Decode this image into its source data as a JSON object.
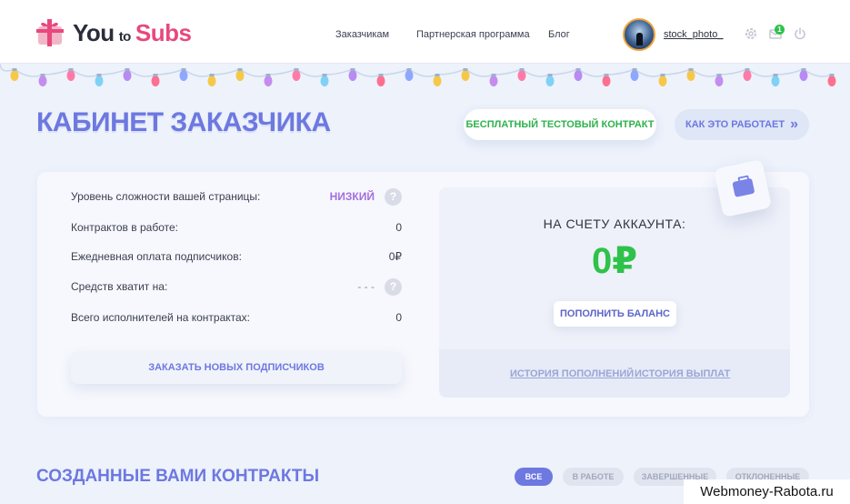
{
  "header": {
    "logo": {
      "you": "You",
      "to": "to",
      "subs": "Subs"
    },
    "nav": [
      {
        "label": "Заказчикам"
      },
      {
        "label": "Партнерская программа"
      },
      {
        "label": "Блог"
      }
    ],
    "username": "stock_photo_",
    "notifications_count": "1"
  },
  "page": {
    "title": "КАБИНЕТ ЗАКАЗЧИКА",
    "free_contract_button": "БЕСПЛАТНЫЙ ТЕСТОВЫЙ КОНТРАКТ",
    "how_it_works_button": "КАК ЭТО РАБОТАЕТ",
    "how_it_works_arrows": "»"
  },
  "stats": [
    {
      "label": "Уровень сложности вашей страницы:",
      "value": "НИЗКИЙ"
    },
    {
      "label": "Контрактов в работе:",
      "value": "0"
    },
    {
      "label": "Ежедневная оплата подписчиков:",
      "value": "0₽"
    },
    {
      "label": "Средств хватит на:",
      "value": "- - -"
    },
    {
      "label": "Всего исполнителей на контрактах:",
      "value": "0"
    }
  ],
  "order_button": "ЗАКАЗАТЬ НОВЫХ ПОДПИСЧИКОВ",
  "balance": {
    "label": "НА СЧЕТУ АККАУНТА:",
    "amount": "0₽",
    "topup_button": "ПОПОЛНИТЬ БАЛАНС",
    "history_topups": "ИСТОРИЯ ПОПОЛНЕНИЙ",
    "history_payouts": "ИСТОРИЯ ВЫПЛАТ"
  },
  "contracts": {
    "title": "СОЗДАННЫЕ ВАМИ КОНТРАКТЫ",
    "filters": [
      {
        "label": "ВСЕ",
        "active": true
      },
      {
        "label": "В РАБОТЕ",
        "active": false
      },
      {
        "label": "ЗАВЕРШЕННЫЕ",
        "active": false
      },
      {
        "label": "ОТКЛОНЕННЫЕ",
        "active": false
      }
    ]
  },
  "watermark": "Webmoney-Rabota.ru",
  "colors": {
    "accent": "#6d78e0",
    "green": "#2fc24a",
    "pink": "#e8487d",
    "level": "#a56ee0"
  },
  "icons": {
    "settings": "gear-icon",
    "mail": "mail-icon",
    "logout": "power-icon",
    "help": "question-icon",
    "wallet": "briefcase-icon"
  }
}
